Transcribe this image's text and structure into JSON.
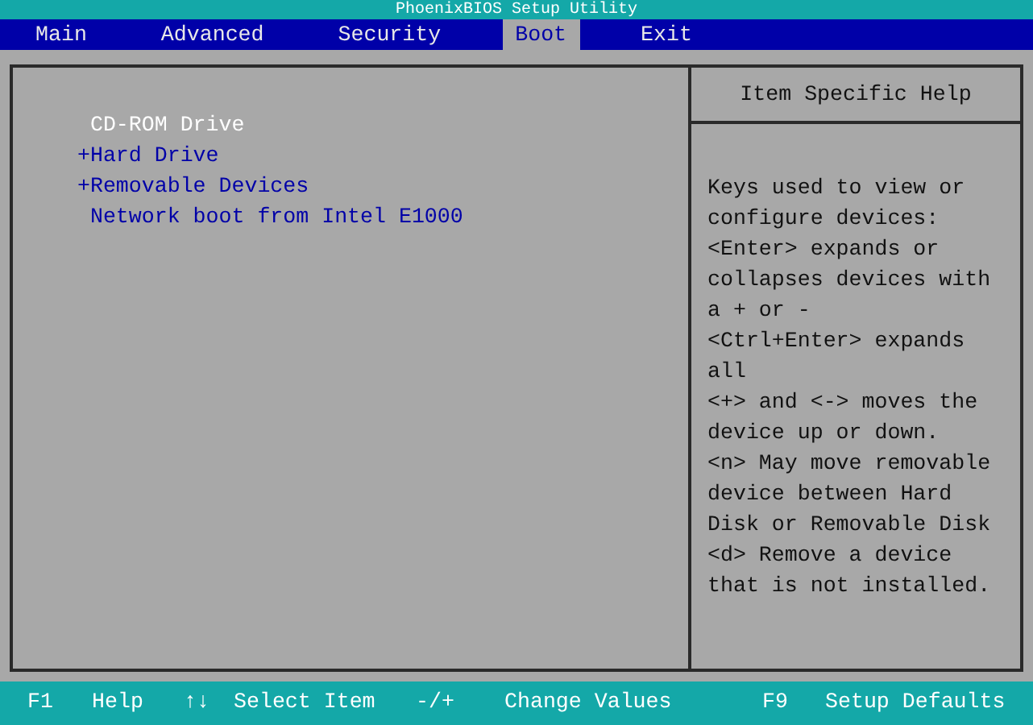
{
  "window": {
    "title": "PhoenixBIOS Setup Utility"
  },
  "tabs": [
    {
      "label": "Main",
      "selected": false
    },
    {
      "label": "Advanced",
      "selected": false
    },
    {
      "label": "Security",
      "selected": false
    },
    {
      "label": "Boot",
      "selected": true
    },
    {
      "label": "Exit",
      "selected": false
    }
  ],
  "boot_items": [
    {
      "label": "CD-ROM Drive",
      "selected": true
    },
    {
      "prefix": "+",
      "label": "Hard Drive",
      "selected": false
    },
    {
      "prefix": "+",
      "label": "Removable Devices",
      "selected": false
    },
    {
      "label": "Network boot from Intel E1000",
      "selected": false
    }
  ],
  "help": {
    "title": "Item Specific Help",
    "lines": [
      "Keys used to view or",
      "configure devices:",
      "<Enter> expands or",
      "collapses devices with",
      "a + or -",
      "<Ctrl+Enter> expands",
      "all",
      "<+> and <-> moves the",
      "device up or down.",
      "<n> May move removable",
      "device between Hard",
      "Disk or Removable Disk",
      "<d> Remove a device",
      "that is not installed."
    ]
  },
  "status_bar": [
    {
      "key": "F1",
      "action": "Help"
    },
    {
      "key": "↑↓",
      "action": "Select Item"
    },
    {
      "key": "-/+",
      "action": "Change Values"
    },
    {
      "key": "F9",
      "action": "Setup Defaults"
    }
  ]
}
